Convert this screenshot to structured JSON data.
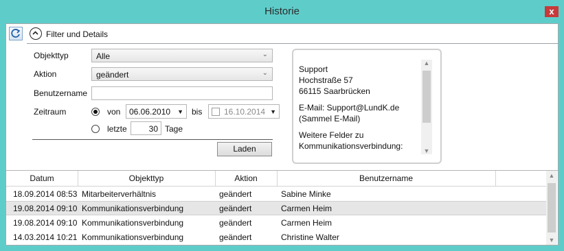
{
  "window": {
    "title": "Historie",
    "close_label": "x"
  },
  "toolbar": {
    "refresh_icon": "refresh-icon",
    "expander_label": "Filter und Details"
  },
  "filter": {
    "objekttyp_label": "Objekttyp",
    "objekttyp_value": "Alle",
    "aktion_label": "Aktion",
    "aktion_value": "geändert",
    "benutzername_label": "Benutzername",
    "benutzername_value": "",
    "zeitraum_label": "Zeitraum",
    "von_label": "von",
    "von_date": "06.06.2010",
    "bis_label": "bis",
    "bis_date": "16.10.2014",
    "letzte_label": "letzte",
    "letzte_value": "30",
    "tage_label": "Tage",
    "laden_label": "Laden"
  },
  "info": {
    "lines": [
      "Support",
      "Hochstraße 57",
      "66115 Saarbrücken",
      "",
      "E-Mail: Support@LundK.de",
      "(Sammel E-Mail)",
      "",
      "Weitere Felder zu",
      "Kommunikationsverbindung:"
    ]
  },
  "table": {
    "headers": [
      "Datum",
      "Objekttyp",
      "Aktion",
      "Benutzername"
    ],
    "rows": [
      [
        "18.09.2014 08:53",
        "Mitarbeiterverhältnis",
        "geändert",
        "Sabine Minke"
      ],
      [
        "19.08.2014 09:10",
        "Kommunikationsverbindung",
        "geändert",
        "Carmen Heim"
      ],
      [
        "19.08.2014 09:10",
        "Kommunikationsverbindung",
        "geändert",
        "Carmen Heim"
      ],
      [
        "14.03.2014 10:21",
        "Kommunikationsverbindung",
        "geändert",
        "Christine Walter"
      ]
    ]
  },
  "colors": {
    "titlebar": "#5ecdca",
    "close": "#c8393a",
    "selected_row": "#e6e6e6"
  }
}
